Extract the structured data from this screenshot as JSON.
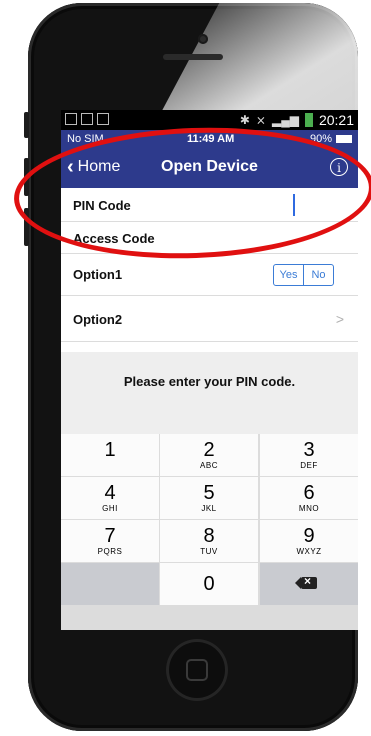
{
  "android_status": {
    "time": "20:21"
  },
  "ios_status": {
    "carrier": "No SIM",
    "time": "11:49 AM",
    "battery": "90%"
  },
  "nav": {
    "back_label": "Home",
    "title": "Open Device",
    "info_symbol": "i"
  },
  "form": {
    "pin_label": "PIN Code",
    "access_label": "Access Code",
    "option1_label": "Option1",
    "option1_yes": "Yes",
    "option1_no": "No",
    "option2_label": "Option2",
    "option2_arrow": ">"
  },
  "prompt": "Please enter your PIN code.",
  "keypad": {
    "k1": {
      "num": "1",
      "letters": ""
    },
    "k2": {
      "num": "2",
      "letters": "ABC"
    },
    "k3": {
      "num": "3",
      "letters": "DEF"
    },
    "k4": {
      "num": "4",
      "letters": "GHI"
    },
    "k5": {
      "num": "5",
      "letters": "JKL"
    },
    "k6": {
      "num": "6",
      "letters": "MNO"
    },
    "k7": {
      "num": "7",
      "letters": "PQRS"
    },
    "k8": {
      "num": "8",
      "letters": "TUV"
    },
    "k9": {
      "num": "9",
      "letters": "WXYZ"
    },
    "k0": {
      "num": "0"
    }
  },
  "colors": {
    "nav_bar": "#2d3a8c",
    "accent": "#3b7cd6",
    "highlight_ring": "#e01010"
  }
}
